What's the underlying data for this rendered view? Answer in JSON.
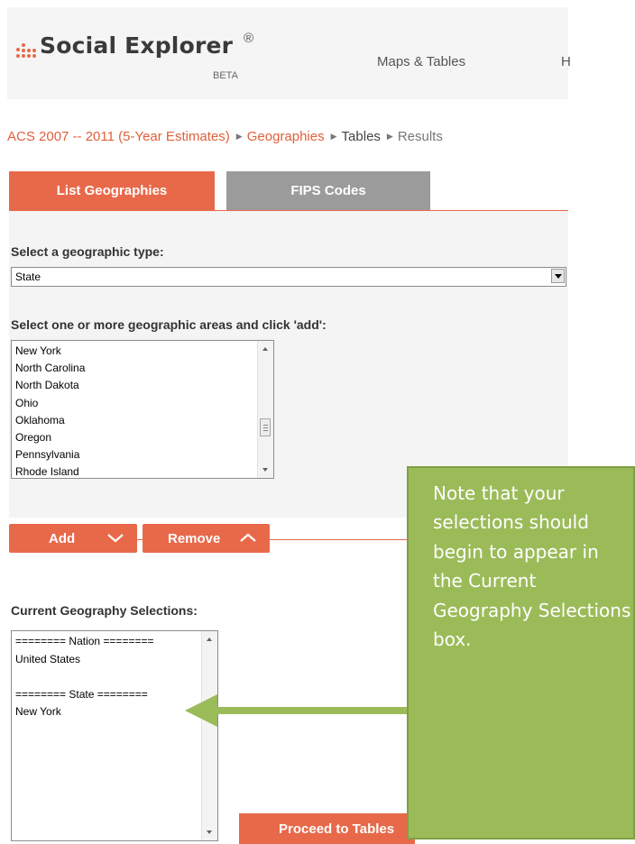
{
  "header": {
    "logo_text": "Social Explorer",
    "logo_reg": "®",
    "logo_beta": "BETA",
    "nav_maps": "Maps & Tables",
    "nav_cut": "H"
  },
  "breadcrumb": {
    "dataset": "ACS 2007 -- 2011 (5-Year Estimates)",
    "sep": "▶",
    "geographies": "Geographies",
    "tables": "Tables",
    "results": "Results"
  },
  "tabs": {
    "list": "List Geographies",
    "fips": "FIPS Codes"
  },
  "geo_type": {
    "label": "Select a geographic type:",
    "selected": "State"
  },
  "areas": {
    "label": "Select one or more geographic areas and click 'add':",
    "items": [
      "New York",
      "North Carolina",
      "North Dakota",
      "Ohio",
      "Oklahoma",
      "Oregon",
      "Pennsylvania",
      "Rhode Island"
    ]
  },
  "buttons": {
    "add": "Add",
    "remove": "Remove",
    "proceed": "Proceed to Tables"
  },
  "selections": {
    "label": "Current Geography Selections:",
    "lines": [
      "======== Nation ========",
      "United States",
      "",
      "======== State ========",
      "New York"
    ]
  },
  "note": {
    "text": "Note that your selections should begin to appear in the Current Geography Selections box."
  },
  "colors": {
    "accent": "#e8694a",
    "tab_inactive": "#9b9b9b",
    "note_bg": "#9bbb59",
    "arrow": "#9bbb59"
  }
}
